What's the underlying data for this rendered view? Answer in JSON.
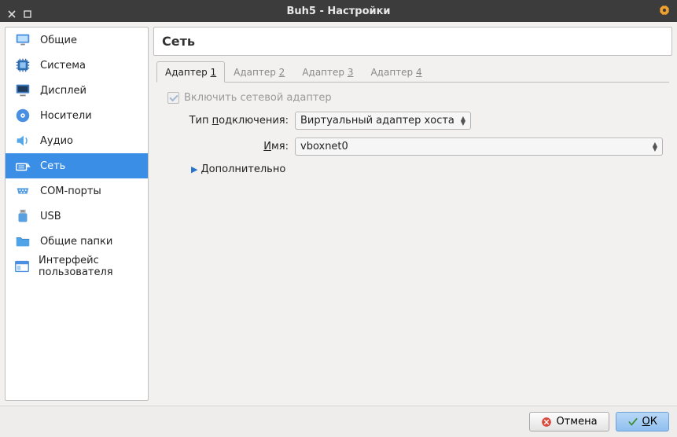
{
  "window": {
    "title": "Buh5 - Настройки"
  },
  "sidebar": {
    "items": [
      {
        "label": "Общие"
      },
      {
        "label": "Система"
      },
      {
        "label": "Дисплей"
      },
      {
        "label": "Носители"
      },
      {
        "label": "Аудио"
      },
      {
        "label": "Сеть"
      },
      {
        "label": "COM-порты"
      },
      {
        "label": "USB"
      },
      {
        "label": "Общие папки"
      },
      {
        "label": "Интерфейс пользователя"
      }
    ],
    "selected_index": 5
  },
  "panel": {
    "title": "Сеть",
    "tabs": [
      {
        "prefix": "Адаптер ",
        "num": "1"
      },
      {
        "prefix": "Адаптер ",
        "num": "2"
      },
      {
        "prefix": "Адаптер ",
        "num": "3"
      },
      {
        "prefix": "Адаптер ",
        "num": "4"
      }
    ],
    "active_tab": 0,
    "enable_adapter_label": "Включить сетевой адаптер",
    "enable_adapter_checked": true,
    "attachment": {
      "label_prefix": "Тип ",
      "label_ul": "п",
      "label_suffix": "одключения:",
      "value": "Виртуальный адаптер хоста"
    },
    "name": {
      "label_ul": "И",
      "label_suffix": "мя:",
      "value": "vboxnet0"
    },
    "advanced": {
      "label_ul": "Д",
      "label_suffix": "ополнительно"
    }
  },
  "footer": {
    "cancel": "Отмена",
    "ok_ul": "O",
    "ok_suffix": "К"
  }
}
